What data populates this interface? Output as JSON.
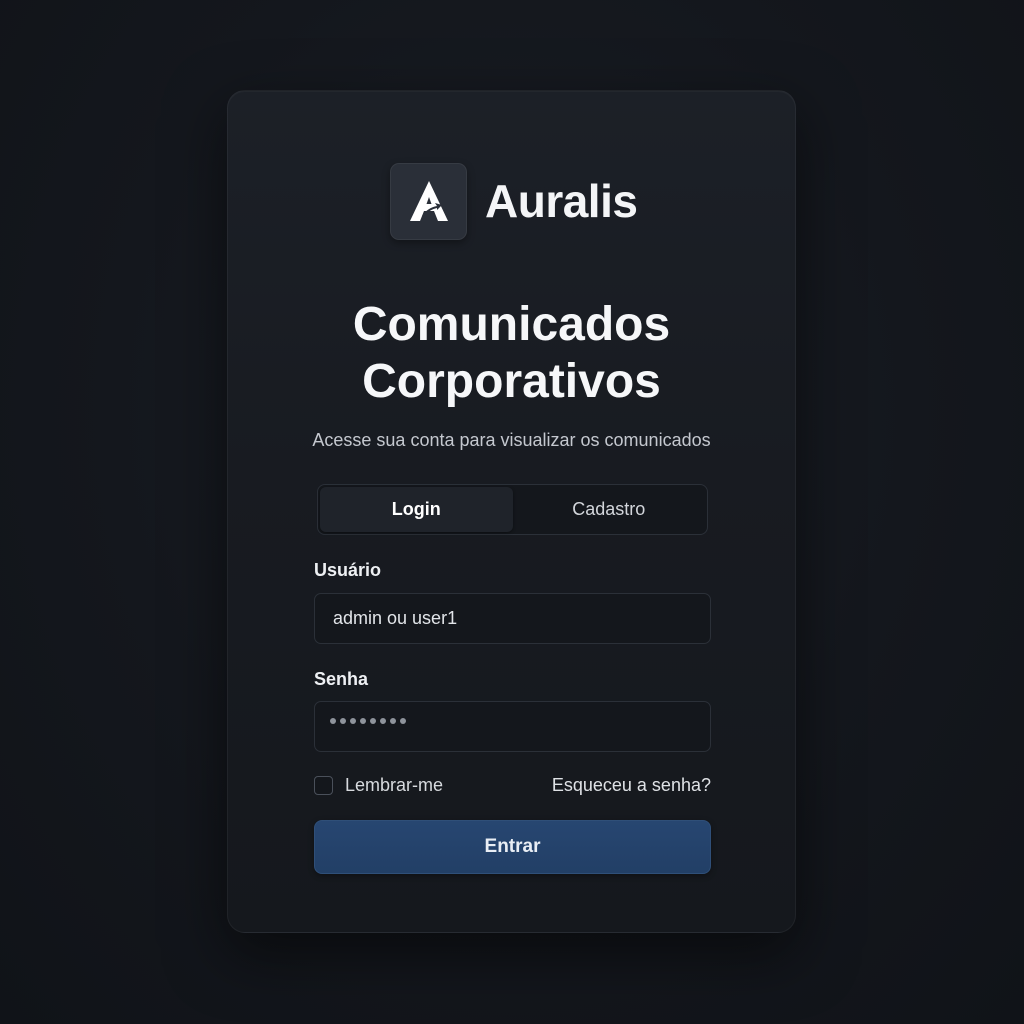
{
  "brand": {
    "name": "Auralis",
    "logo_icon": "auralis-logo-icon"
  },
  "login": {
    "title_line1": "Comunicados",
    "title_line2": "Corporativos",
    "subtitle": "Acesse sua conta para visualizar os comunicados",
    "tabs": [
      {
        "label": "Login",
        "active": true
      },
      {
        "label": "Cadastro",
        "active": false
      }
    ],
    "username": {
      "label": "Usuário",
      "placeholder": "admin ou user1",
      "value": ""
    },
    "password": {
      "label": "Senha",
      "masked_value": "••••••••",
      "length": 8
    },
    "remember_label": "Lembrar-me",
    "remember_checked": false,
    "forgot_label": "Esqueceu a senha?",
    "submit_label": "Entrar"
  },
  "colors": {
    "background": "#14171d",
    "card": "#1a1d23",
    "accent": "#244470"
  }
}
